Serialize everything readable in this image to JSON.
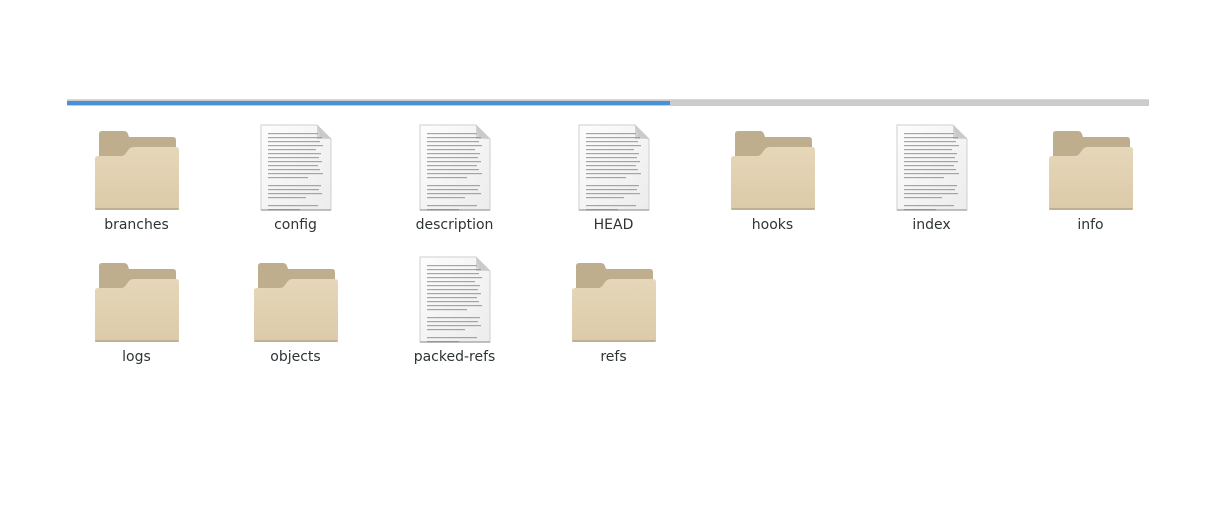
{
  "progress": {
    "fraction": 0.557
  },
  "colors": {
    "accent": "#4a90d9",
    "folder_back": "#bfae8e",
    "folder_front": "#e6d7ba",
    "text": "#2e3436"
  },
  "files": [
    {
      "name": "branches",
      "type": "folder",
      "icon": "folder-icon"
    },
    {
      "name": "config",
      "type": "file",
      "icon": "text-file-icon"
    },
    {
      "name": "description",
      "type": "file",
      "icon": "text-file-icon"
    },
    {
      "name": "HEAD",
      "type": "file",
      "icon": "text-file-icon"
    },
    {
      "name": "hooks",
      "type": "folder",
      "icon": "folder-icon"
    },
    {
      "name": "index",
      "type": "file",
      "icon": "text-file-icon"
    },
    {
      "name": "info",
      "type": "folder",
      "icon": "folder-icon"
    },
    {
      "name": "logs",
      "type": "folder",
      "icon": "folder-icon"
    },
    {
      "name": "objects",
      "type": "folder",
      "icon": "folder-icon"
    },
    {
      "name": "packed-refs",
      "type": "file",
      "icon": "text-file-icon"
    },
    {
      "name": "refs",
      "type": "folder",
      "icon": "folder-icon"
    }
  ]
}
